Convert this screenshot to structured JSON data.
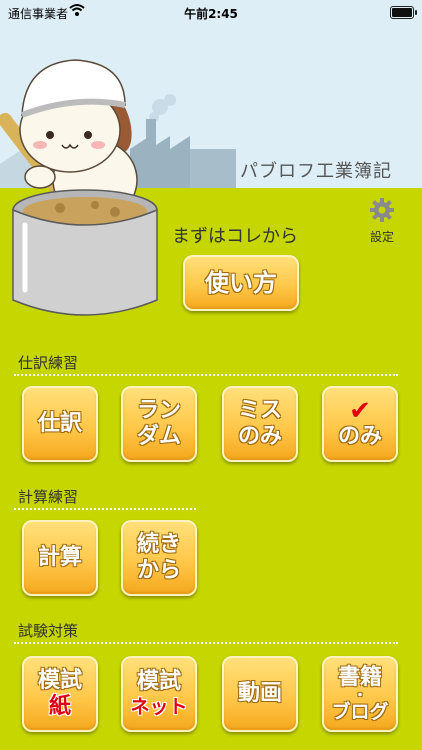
{
  "status_bar": {
    "carrier": "通信事業者",
    "time": "午前2:45"
  },
  "header": {
    "app_title": "パブロフ工業簿記"
  },
  "intro": {
    "start_label": "まずはコレから",
    "settings_label": "設定",
    "howto_button": "使い方"
  },
  "sections": {
    "shiwake": {
      "title": "仕訳練習",
      "buttons": {
        "shiwake": "仕訳",
        "random_line1": "ラン",
        "random_line2": "ダム",
        "miss_line1": "ミス",
        "miss_line2": "のみ",
        "checked_mark": "✔",
        "checked_label": "のみ"
      }
    },
    "keisan": {
      "title": "計算練習",
      "buttons": {
        "keisan": "計算",
        "continue_line1": "続き",
        "continue_line2": "から"
      }
    },
    "shiken": {
      "title": "試験対策",
      "buttons": {
        "mock_paper_line1": "模試",
        "mock_paper_line2": "紙",
        "mock_net_line1": "模試",
        "mock_net_line2": "ネット",
        "video": "動画",
        "books_line1": "書籍",
        "books_dot": "・",
        "books_line2": "ブログ"
      }
    }
  },
  "colors": {
    "background": "#c6d600",
    "sky": "#ddeef6",
    "button_orange": "#ffc84a",
    "accent_red": "#e00010"
  }
}
